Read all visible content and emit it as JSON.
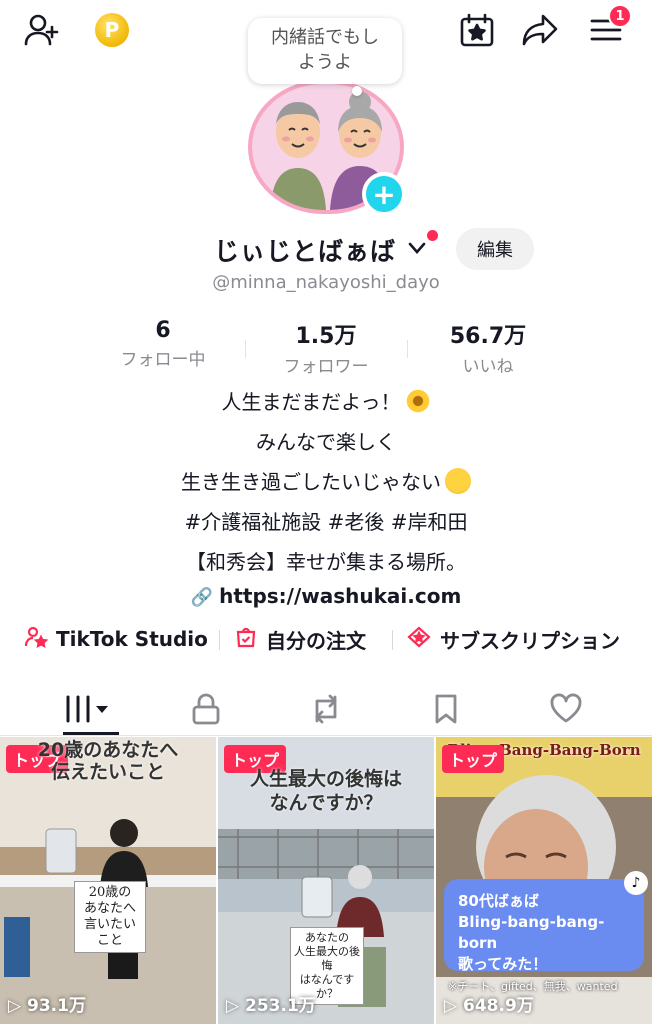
{
  "topbar": {
    "icons": [
      "add-friend-icon",
      "coin-icon",
      "calendar-star-icon",
      "share-icon",
      "menu-icon"
    ],
    "coin_label": "P",
    "notification_count": "1"
  },
  "profile": {
    "note_text_line1": "内緒話でもし",
    "note_text_line2": "ようよ",
    "display_name": "じぃじとばぁば",
    "edit_label": "編集",
    "username": "@minna_nakayoshi_dayo"
  },
  "stats": [
    {
      "value": "6",
      "label": "フォロー中"
    },
    {
      "value": "1.5万",
      "label": "フォロワー"
    },
    {
      "value": "56.7万",
      "label": "いいね"
    }
  ],
  "bio": {
    "line1": "人生まだまだよっ！",
    "line2": "みんなで楽しく",
    "line3": "生き生き過ごしたいじゃない",
    "line4": "#介護福祉施設 #老後 #岸和田",
    "line5": "【和秀会】幸せが集まる場所。",
    "link": "https://washukai.com"
  },
  "actions": [
    {
      "label": "TikTok Studio",
      "icon": "person-star-icon"
    },
    {
      "label": "自分の注文",
      "icon": "order-bag-icon"
    },
    {
      "label": "サブスクリプション",
      "icon": "subscription-icon"
    }
  ],
  "tabs": [
    "grid-icon",
    "lock-icon",
    "repost-icon",
    "bookmark-icon",
    "heart-icon"
  ],
  "videos": [
    {
      "tag": "トップ",
      "title": "20歳のあなたへ\n伝えたいこと",
      "sign": "20歳の\nあなたへ\n言いたいこと",
      "views": "93.1万"
    },
    {
      "tag": "トップ",
      "title": "人生最大の後悔は\nなんですか？",
      "sign": "あなたの\n人生最大の後悔\nはなんですか？",
      "views": "253.1万"
    },
    {
      "tag": "トップ",
      "title": "Bling-Bang-Bang-Born",
      "card_line1": "80代ばぁば",
      "card_line2": "Bling-bang-bang-born",
      "card_line3": "歌ってみた！",
      "watermark": "※チート、gifted、無我、wanted",
      "views": "648.9万"
    }
  ],
  "colors": {
    "accent": "#fe2c55",
    "plus": "#20d5ec",
    "text": "#161823",
    "muted": "#8a8b91"
  }
}
